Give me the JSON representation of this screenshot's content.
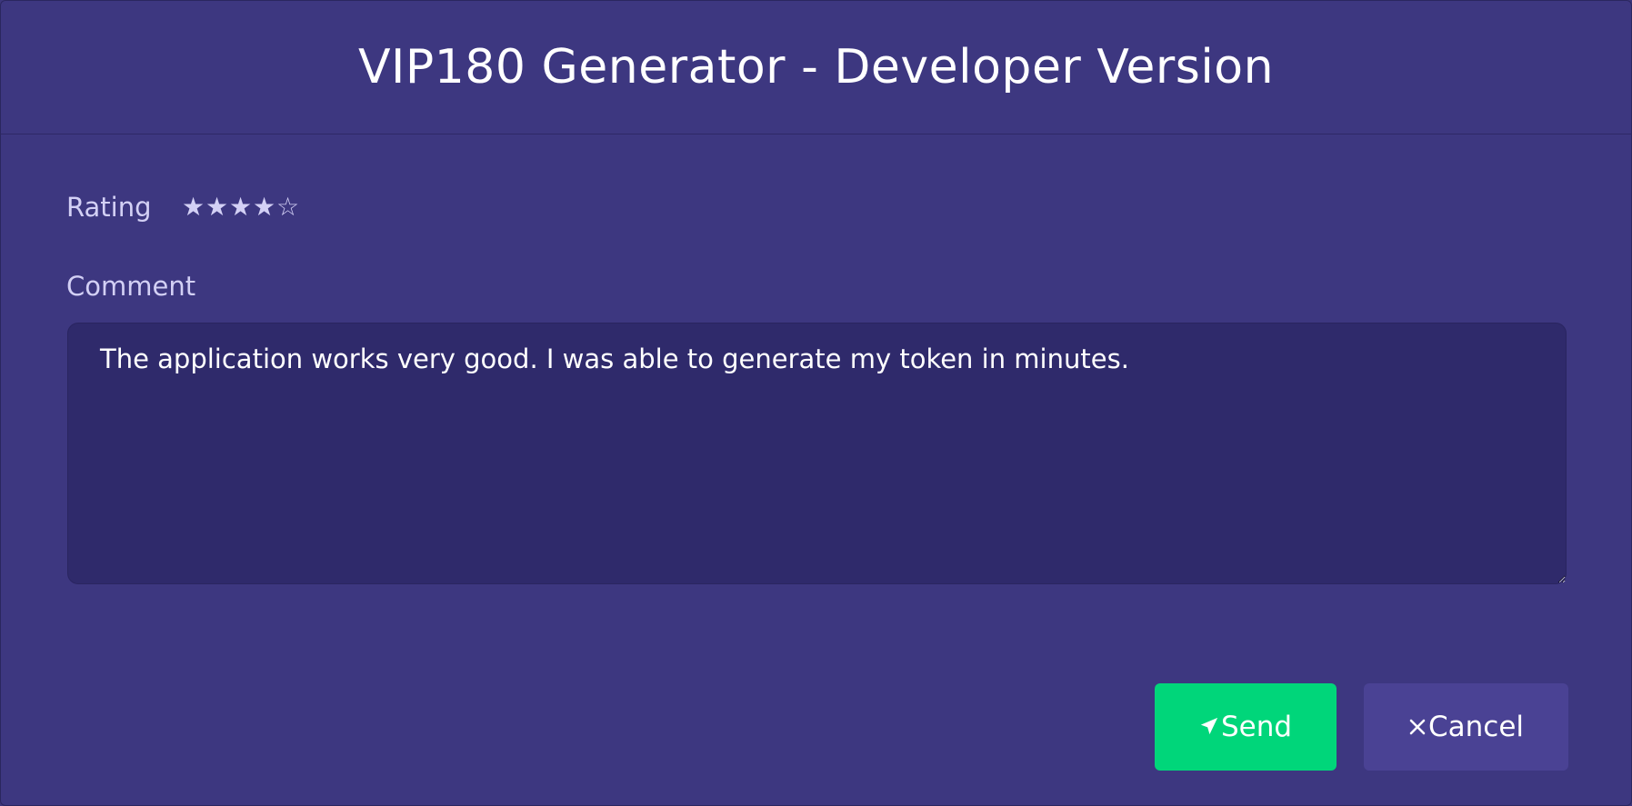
{
  "dialog": {
    "title": "VIP180 Generator - Developer Version"
  },
  "rating": {
    "label": "Rating",
    "value": 4,
    "max": 5,
    "stars": [
      "★",
      "★",
      "★",
      "★",
      "☆"
    ]
  },
  "comment": {
    "label": "Comment",
    "value": "The application works very good. I was able to generate my token in minutes."
  },
  "actions": {
    "send_icon": "paper-plane-icon",
    "send_label": "Send",
    "cancel_icon": "close-icon",
    "cancel_label": "Cancel"
  },
  "colors": {
    "background": "#3d3780",
    "textarea_background": "#2f2a6b",
    "send_button": "#00d67a",
    "cancel_button": "#4a4294",
    "label_text": "#d3d0f5"
  }
}
